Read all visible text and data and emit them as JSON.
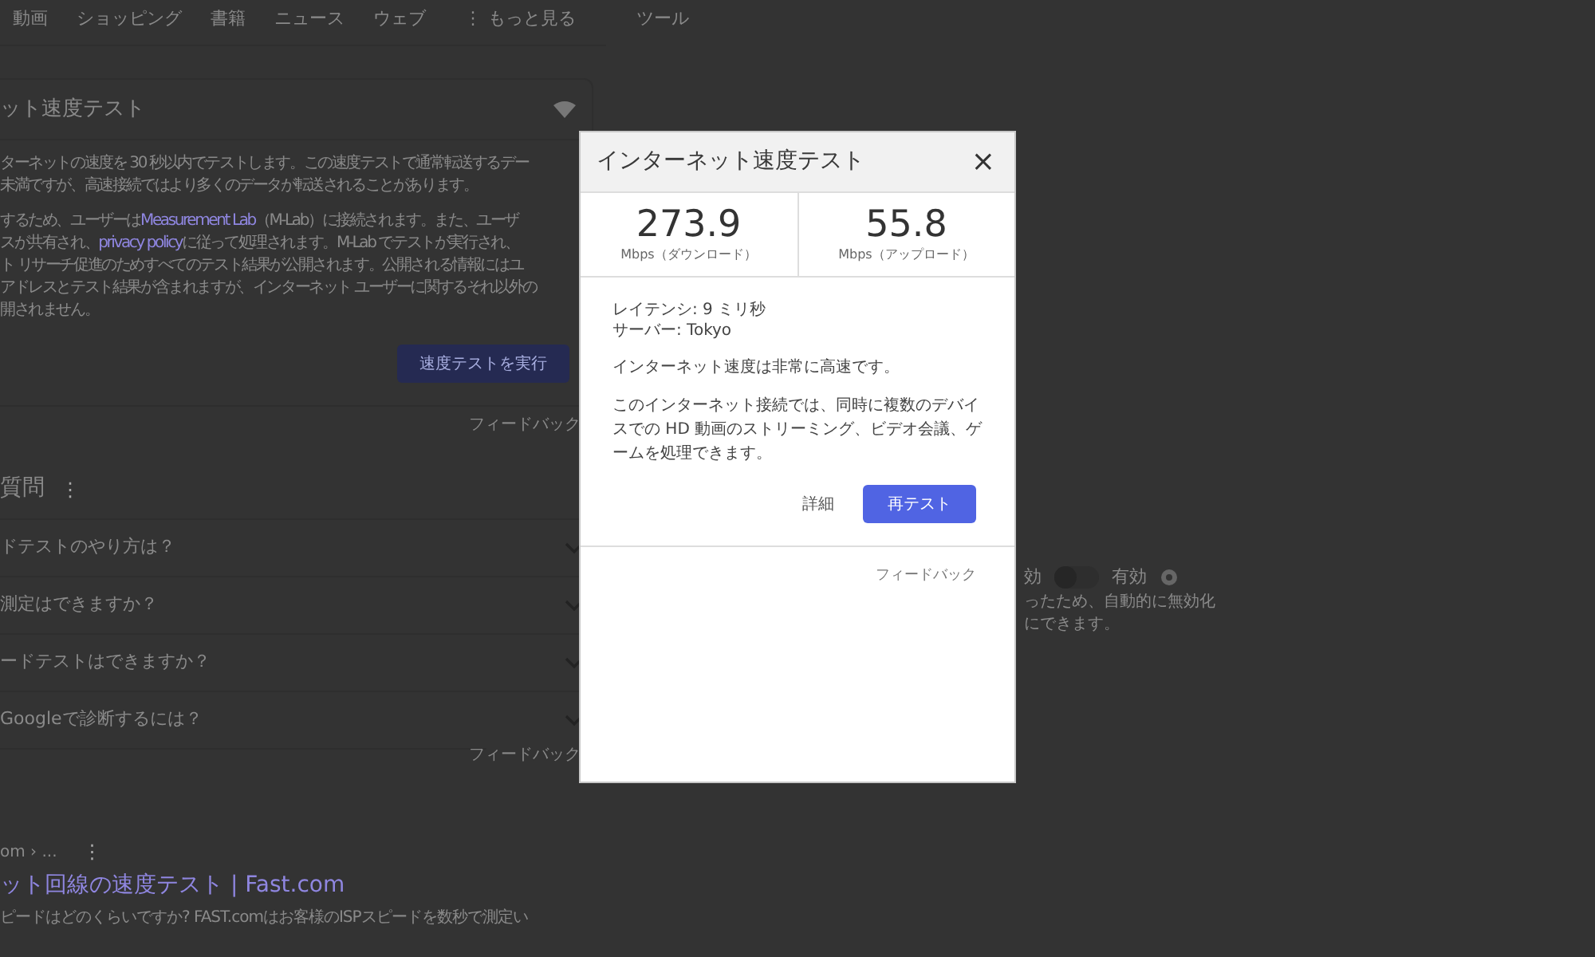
{
  "nav": {
    "tabs": [
      "動画",
      "ショッピング",
      "書籍",
      "ニュース",
      "ウェブ"
    ],
    "more_icon": "⋮",
    "more": "もっと見る",
    "tools": "ツール"
  },
  "speed_card": {
    "title": "ット速度テスト",
    "lines": [
      {
        "before": "ターネットの速度を 30 秒以内でテストします。この速度テストで通常転送するデー"
      },
      {
        "before": "未満ですが、高速接続ではより多くのデータが転送されることがあります。"
      },
      {
        "before": "するため、ユーザーは ",
        "link": "Measurement Lab",
        "after": "（M-Lab）に接続されます。また、ユーザ"
      },
      {
        "before": "スが共有され、",
        "link": "privacy policy",
        "after": "に従って処理されます。M-Lab でテストが実行され、"
      },
      {
        "before": "ト リサーチ促進のためすべてのテスト結果が公開されます。公開される情報にはユ"
      },
      {
        "before": "アドレスとテスト結果が含まれますが、インターネット ユーザーに関するそれ以外の"
      },
      {
        "before": "開されません。"
      }
    ],
    "run_button": "速度テストを実行",
    "feedback": "フィードバック"
  },
  "faq": {
    "title": "質問",
    "menu_icon": "⋮",
    "items": [
      {
        "question": "ドテストのやり方は？",
        "expanded": false
      },
      {
        "question": "測定はできますか？",
        "expanded": false
      },
      {
        "question": "ードテストはできますか？",
        "expanded": false
      },
      {
        "question": "Googleで診断するには？",
        "expanded": false
      }
    ],
    "feedback": "フィードバック"
  },
  "result": {
    "breadcrumb": "om › ...",
    "menu_icon": "⋮",
    "title": "ット回線の速度テスト | Fast.com",
    "snippet": "ピードはどのくらいですか? FAST.comはお客様のISPスピードを数秒で測定い"
  },
  "side_setting": {
    "off_label": "効",
    "on_label": "有効",
    "on": false,
    "lines": [
      "ったため、自動的に無効化",
      "にできます。"
    ]
  },
  "dialog": {
    "title": "インターネット速度テスト",
    "close": "×",
    "speeds": [
      {
        "value": "273.9",
        "unit": "Mbps（ダウンロード）"
      },
      {
        "value": "55.8",
        "unit": "Mbps（アップロード）"
      }
    ],
    "latency": "レイテンシ: 9 ミリ秒",
    "server": "サーバー: Tokyo",
    "summary": "インターネット速度は非常に高速です。",
    "description": "このインターネット接続では、同時に複数のデバイスでの HD 動画のストリーミング、ビデオ会議、ゲームを処理できます。",
    "details_button": "詳細",
    "retest_button": "再テスト",
    "feedback": "フィードバック"
  }
}
